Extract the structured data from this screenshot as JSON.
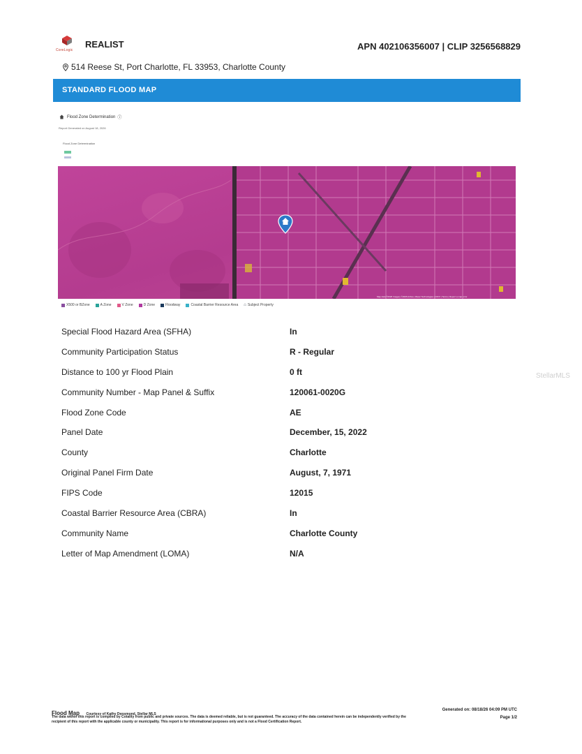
{
  "header": {
    "logo_text": "CoreLogic",
    "brand": "REALIST",
    "apn": "APN 402106356007 | CLIP 3256568829"
  },
  "address": "514 Reese St, Port Charlotte, FL 33953, Charlotte County",
  "banner": "STANDARD FLOOD MAP",
  "determination": {
    "title": "Flood Zone Determination",
    "generated": "Report Generated on August 18, 2026",
    "legend_title": "Flood Zone Determination",
    "swatch_labels": [
      "1000",
      "LIMIT"
    ]
  },
  "map": {
    "attribution": "Map data ©2026 Imagery ©2026 Airbus, Maxar Technologies | 100 ft | Terms | Report a map error"
  },
  "legend": [
    {
      "label": "X500 or BZone",
      "color": "#8a4fa0"
    },
    {
      "label": "A Zone",
      "color": "#2aa39a"
    },
    {
      "label": "V Zone",
      "color": "#e05a8a"
    },
    {
      "label": "D Zone",
      "color": "#b03aa0"
    },
    {
      "label": "Floodway",
      "color": "#1b3a5c"
    },
    {
      "label": "Coastal Barrier Resource Area",
      "color": "#39b1c8"
    },
    {
      "label": "Subject Property",
      "color": "#4a5560"
    }
  ],
  "rows": [
    {
      "label": "Special Flood Hazard Area (SFHA)",
      "value": "In"
    },
    {
      "label": "Community Participation Status",
      "value": "R - Regular"
    },
    {
      "label": "Distance to 100 yr Flood Plain",
      "value": "0 ft"
    },
    {
      "label": "Community Number - Map Panel & Suffix",
      "value": "120061-0020G"
    },
    {
      "label": "Flood Zone Code",
      "value": "AE"
    },
    {
      "label": "Panel Date",
      "value": "December, 15, 2022"
    },
    {
      "label": "County",
      "value": "Charlotte"
    },
    {
      "label": "Original Panel Firm Date",
      "value": "August, 7, 1971"
    },
    {
      "label": "FIPS Code",
      "value": "12015"
    },
    {
      "label": "Coastal Barrier Resource Area (CBRA)",
      "value": "In"
    },
    {
      "label": "Community Name",
      "value": "Charlotte County"
    },
    {
      "label": "Letter of Map Amendment (LOMA)",
      "value": "N/A"
    }
  ],
  "watermark": "StellarMLS",
  "footer": {
    "title": "Flood Map",
    "courtesy": "Courtesy of Kathy Densmond, Stellar MLS",
    "disclaimer": "The data within this report is compiled by Cotality from public and private sources. The data is deemed reliable, but is not guaranteed. The accuracy of the data contained herein can be independently verified by the recipient of this report with the applicable county or municipality. This report is for informational purposes only and is not a Flood Certification Report.",
    "generated": "Generated on: 08/18/26 04:09 PM UTC",
    "page": "Page 1/2"
  }
}
